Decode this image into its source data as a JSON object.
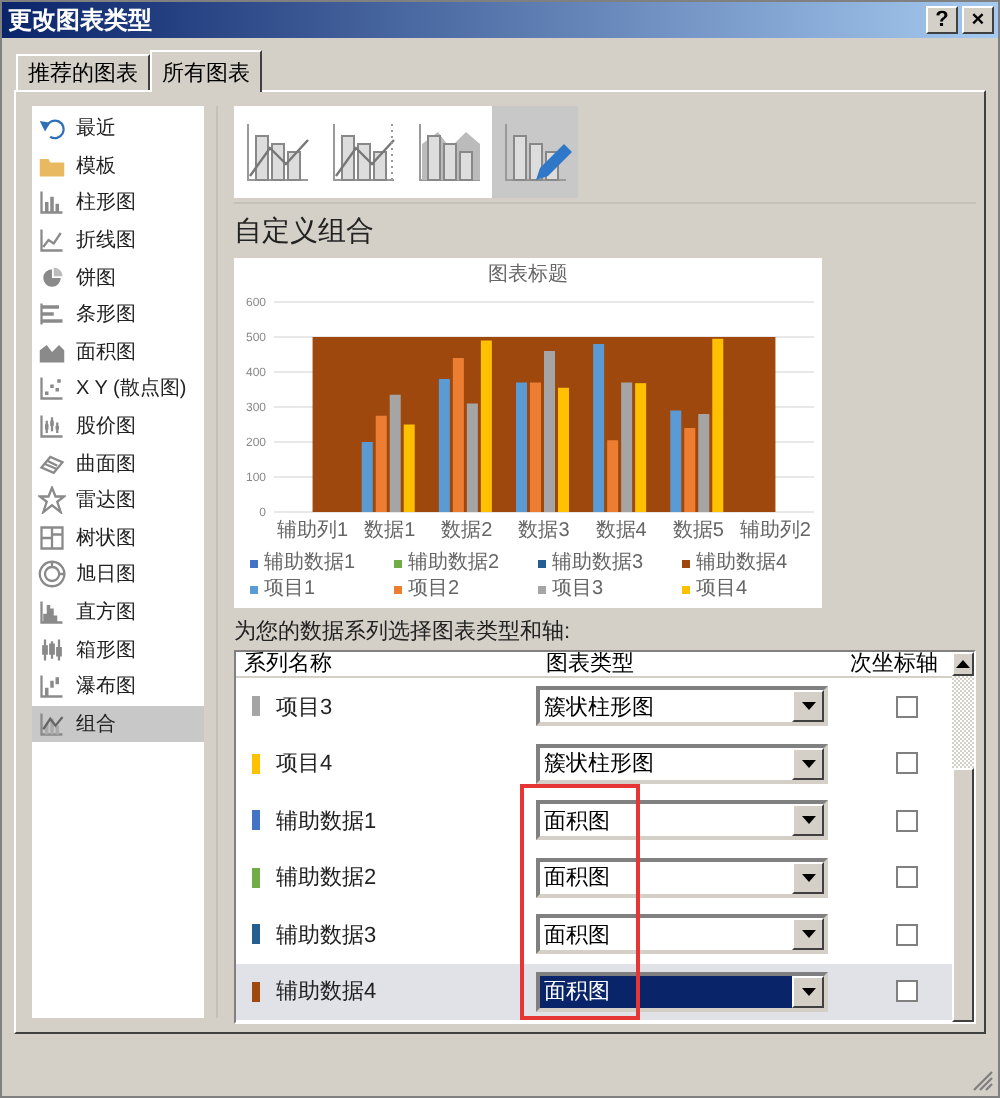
{
  "window": {
    "title": "更改图表类型",
    "help_button": "?",
    "close_button": "×"
  },
  "tabs": [
    {
      "label": "推荐的图表",
      "selected": false
    },
    {
      "label": "所有图表",
      "selected": true
    }
  ],
  "sidebar": {
    "items": [
      {
        "label": "最近",
        "selected": false
      },
      {
        "label": "模板",
        "selected": false
      },
      {
        "label": "柱形图",
        "selected": false
      },
      {
        "label": "折线图",
        "selected": false
      },
      {
        "label": "饼图",
        "selected": false
      },
      {
        "label": "条形图",
        "selected": false
      },
      {
        "label": "面积图",
        "selected": false
      },
      {
        "label": "X Y (散点图)",
        "selected": false
      },
      {
        "label": "股价图",
        "selected": false
      },
      {
        "label": "曲面图",
        "selected": false
      },
      {
        "label": "雷达图",
        "selected": false
      },
      {
        "label": "树状图",
        "selected": false
      },
      {
        "label": "旭日图",
        "selected": false
      },
      {
        "label": "直方图",
        "selected": false
      },
      {
        "label": "箱形图",
        "selected": false
      },
      {
        "label": "瀑布图",
        "selected": false
      },
      {
        "label": "组合",
        "selected": true
      }
    ]
  },
  "subtypes": [
    {
      "selected": false
    },
    {
      "selected": false
    },
    {
      "selected": false
    },
    {
      "selected": true
    }
  ],
  "heading": "自定义组合",
  "preview": {
    "chart_data": {
      "type": "bar",
      "title": "图表标题",
      "categories": [
        "辅助列1",
        "数据1",
        "数据2",
        "数据3",
        "数据4",
        "数据5",
        "辅助列2"
      ],
      "ylim": [
        0,
        600
      ],
      "stacked": false,
      "grid": true,
      "legend": "bottom",
      "yticks": [
        0,
        100,
        200,
        300,
        400,
        500,
        600
      ],
      "series": [
        {
          "name": "辅助数据1",
          "color": "#4472c4",
          "values": [
            null,
            null,
            null,
            null,
            null,
            null,
            null
          ]
        },
        {
          "name": "辅助数据2",
          "color": "#70ad47",
          "values": [
            null,
            null,
            null,
            null,
            null,
            null,
            null
          ]
        },
        {
          "name": "辅助数据3",
          "color": "#255e91",
          "values": [
            null,
            null,
            null,
            null,
            null,
            null,
            null
          ]
        },
        {
          "name": "辅助数据4",
          "color": "#9e480e",
          "type": "area",
          "values": [
            500,
            500,
            500,
            500,
            500,
            500,
            500
          ]
        },
        {
          "name": "项目1",
          "color": "#5b9bd5",
          "values": [
            null,
            200,
            380,
            370,
            480,
            290,
            null
          ]
        },
        {
          "name": "项目2",
          "color": "#ed7d31",
          "values": [
            null,
            275,
            440,
            370,
            205,
            240,
            null
          ]
        },
        {
          "name": "项目3",
          "color": "#a5a5a5",
          "values": [
            null,
            335,
            310,
            460,
            370,
            280,
            null
          ]
        },
        {
          "name": "项目4",
          "color": "#ffc000",
          "values": [
            null,
            250,
            490,
            355,
            368,
            495,
            null
          ]
        }
      ]
    }
  },
  "series_label": "为您的数据系列选择图表类型和轴:",
  "table": {
    "columns": [
      "系列名称",
      "图表类型",
      "次坐标轴"
    ],
    "rows": [
      {
        "name": "项目3",
        "color": "#a5a5a5",
        "chart_type": "簇状柱形图",
        "secondary_axis": false,
        "selected": false
      },
      {
        "name": "项目4",
        "color": "#ffc000",
        "chart_type": "簇状柱形图",
        "secondary_axis": false,
        "selected": false
      },
      {
        "name": "辅助数据1",
        "color": "#4472c4",
        "chart_type": "面积图",
        "secondary_axis": false,
        "selected": false
      },
      {
        "name": "辅助数据2",
        "color": "#70ad47",
        "chart_type": "面积图",
        "secondary_axis": false,
        "selected": false
      },
      {
        "name": "辅助数据3",
        "color": "#255e91",
        "chart_type": "面积图",
        "secondary_axis": false,
        "selected": false
      },
      {
        "name": "辅助数据4",
        "color": "#9e480e",
        "chart_type": "面积图",
        "secondary_axis": false,
        "selected": true
      }
    ]
  }
}
